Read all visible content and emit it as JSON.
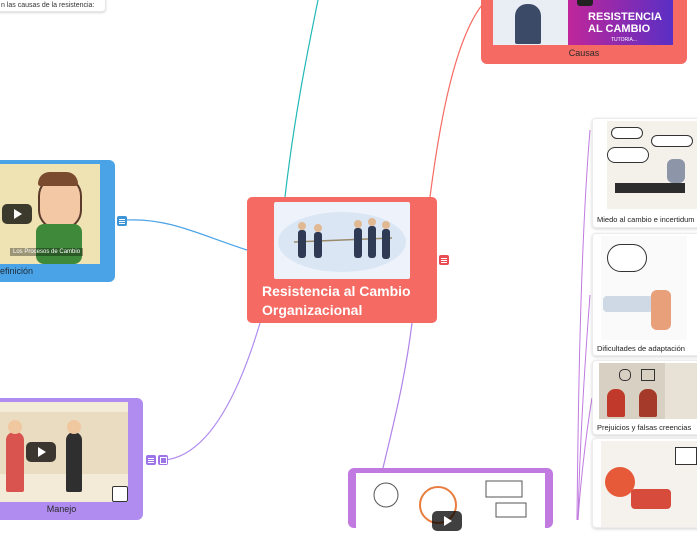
{
  "central": {
    "title": "Resistencia al Cambio Organizacional"
  },
  "note": {
    "text": "n las causas de la resistencia:"
  },
  "nodes": {
    "causas": {
      "label": "Causas",
      "banner_line1": "RESISTENCIA",
      "banner_line2": "AL CAMBIO",
      "banner_small": "TUTORIA..."
    },
    "definicion": {
      "label": "efinición",
      "caption": "Los Procesos de Cambio"
    },
    "manejo": {
      "label": "Manejo"
    }
  },
  "side_cards": [
    {
      "label": "Miedo al cambio e incertidum"
    },
    {
      "label": "Dificultades de adaptación"
    },
    {
      "label": "Prejuicios y falsas creencias"
    },
    {
      "label": ""
    }
  ],
  "colors": {
    "central": "#f56a62",
    "causas": "#f56a62",
    "definicion": "#4aa3e6",
    "manejo": "#b18cf0",
    "bottom": "#c07ae0",
    "line_teal": "#22b8b8",
    "line_purple": "#b283e8"
  },
  "icons": [
    "notes-icon",
    "play-icon",
    "attachment-icon"
  ]
}
